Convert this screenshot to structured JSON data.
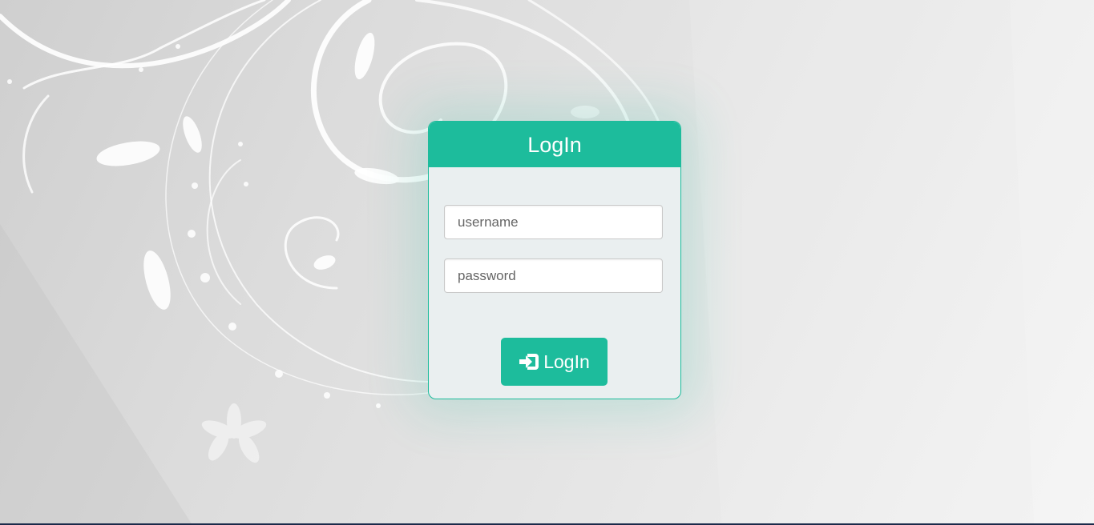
{
  "login": {
    "title": "LogIn",
    "username_placeholder": "username",
    "password_placeholder": "password",
    "button_label": "LogIn",
    "button_icon": "sign-in-icon"
  },
  "colors": {
    "accent": "#1dbc9c",
    "card_background": "#eaeff0",
    "page_background": "#dcdcdc"
  }
}
